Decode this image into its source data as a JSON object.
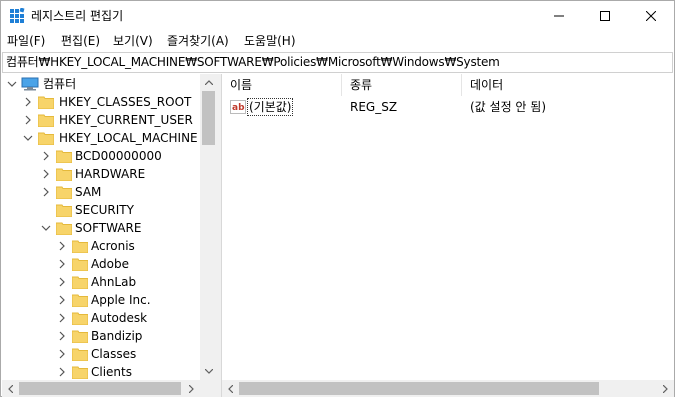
{
  "window": {
    "title": "레지스트리 편집기",
    "icon": "registry-editor-icon"
  },
  "menu": {
    "items": [
      {
        "label": "파일(F)"
      },
      {
        "label": "편집(E)"
      },
      {
        "label": "보기(V)"
      },
      {
        "label": "즐겨찾기(A)"
      },
      {
        "label": "도움말(H)"
      }
    ]
  },
  "address": {
    "path": "컴퓨터₩HKEY_LOCAL_MACHINE₩SOFTWARE₩Policies₩Microsoft₩Windows₩System"
  },
  "tree": {
    "root": "컴퓨터",
    "hives": [
      {
        "label": "HKEY_CLASSES_ROOT",
        "expanded": false
      },
      {
        "label": "HKEY_CURRENT_USER",
        "expanded": false
      },
      {
        "label": "HKEY_LOCAL_MACHINE",
        "expanded": true
      }
    ],
    "hklm_children": [
      {
        "label": "BCD00000000",
        "has_children": true
      },
      {
        "label": "HARDWARE",
        "has_children": true
      },
      {
        "label": "SAM",
        "has_children": true
      },
      {
        "label": "SECURITY",
        "has_children": false
      },
      {
        "label": "SOFTWARE",
        "has_children": true,
        "expanded": true
      }
    ],
    "software_children": [
      {
        "label": "Acronis"
      },
      {
        "label": "Adobe"
      },
      {
        "label": "AhnLab"
      },
      {
        "label": "Apple Inc."
      },
      {
        "label": "Autodesk"
      },
      {
        "label": "Bandizip"
      },
      {
        "label": "Classes"
      },
      {
        "label": "Clients"
      }
    ]
  },
  "list": {
    "columns": [
      {
        "label": "이름"
      },
      {
        "label": "종류"
      },
      {
        "label": "데이터"
      }
    ],
    "rows": [
      {
        "name": "(기본값)",
        "type": "REG_SZ",
        "data": "(값 설정 안 됨)",
        "icon": "string-value-icon"
      }
    ]
  },
  "colors": {
    "folder": "#f7d46a",
    "folder_dark": "#e5b93b",
    "selection_border": "#333333"
  }
}
